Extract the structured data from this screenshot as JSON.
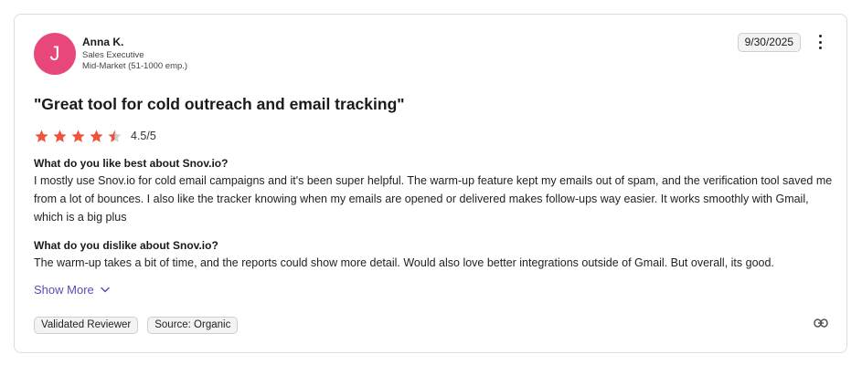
{
  "reviewer": {
    "avatar_letter": "J",
    "avatar_color": "#e8477a",
    "name": "Anna K.",
    "role": "Sales Executive",
    "segment": "Mid-Market (51-1000 emp.)"
  },
  "review": {
    "date": "9/30/2025",
    "title": "\"Great tool for cold outreach and email tracking\"",
    "rating": 4.5,
    "rating_max": 5,
    "rating_text": "4.5/5",
    "star_color": "#f1523d",
    "questions": [
      {
        "question": "What do you like best about Snov.io?",
        "answer": "I mostly use Snov.io for cold email campaigns and it's been super helpful. The warm-up feature kept my emails out of spam, and the verification tool saved me from a lot of bounces. I also like the tracker knowing when my emails are opened or delivered makes follow-ups way easier. It works smoothly with Gmail, which is a big plus"
      },
      {
        "question": "What do you dislike about Snov.io?",
        "answer": "The warm-up takes a bit of time, and the reports could show more detail. Would also love better integrations outside of Gmail. But overall, its good."
      }
    ],
    "show_more_label": "Show More",
    "tags": [
      "Validated Reviewer",
      "Source: Organic"
    ]
  },
  "icons": {
    "more": "more-vertical-icon",
    "chevron": "chevron-down-icon",
    "link": "link-icon",
    "star": "star-icon"
  },
  "accent_color": "#5b4bb7"
}
